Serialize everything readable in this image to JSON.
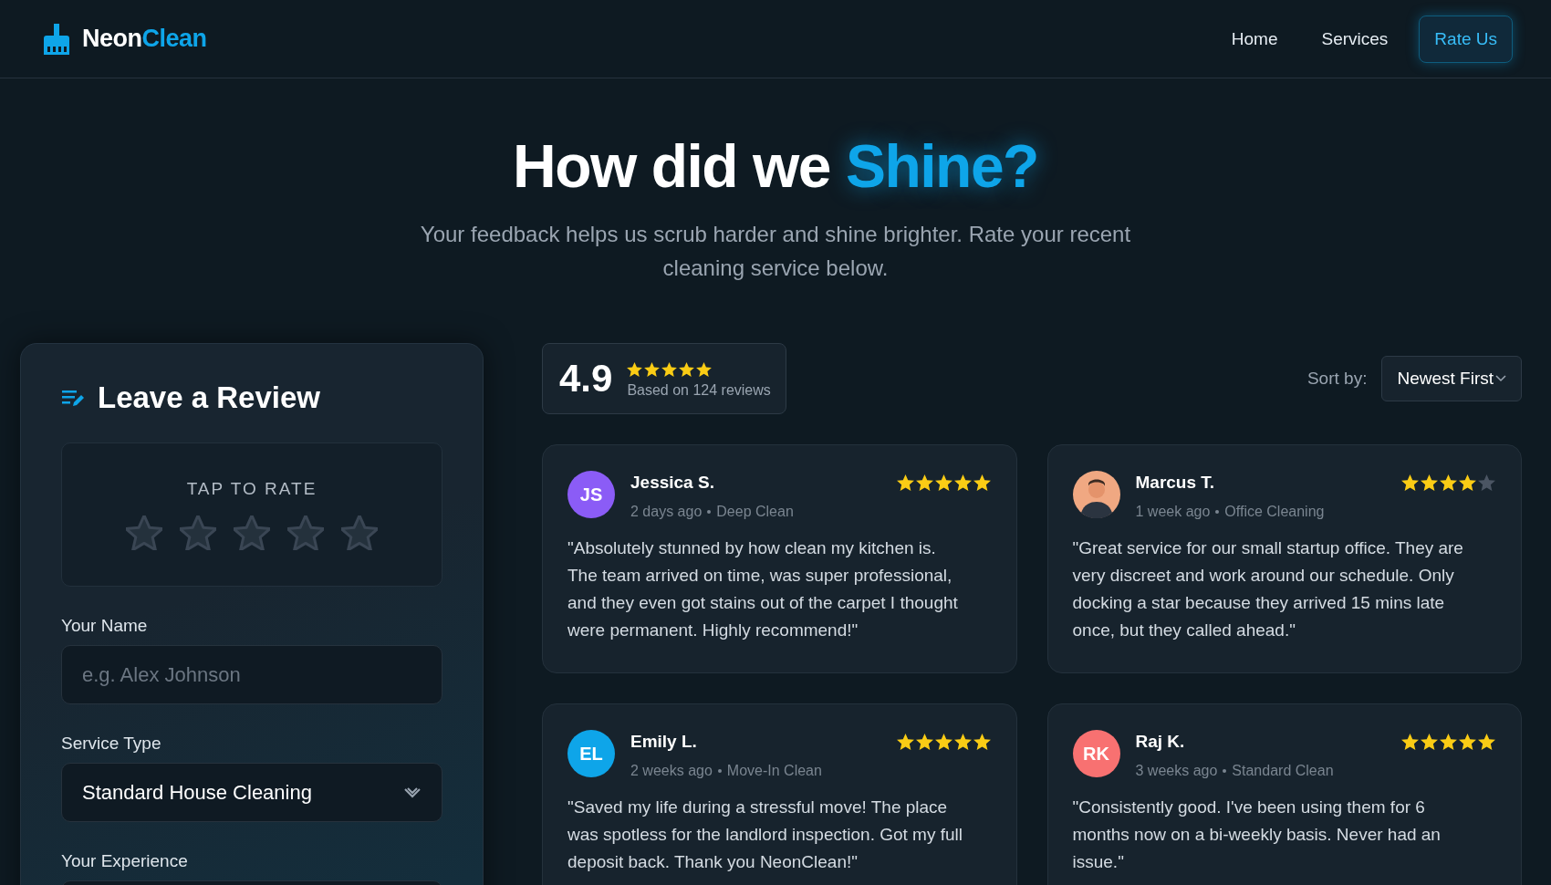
{
  "brand": {
    "name_plain": "Neon",
    "name_accent": "Clean"
  },
  "nav": [
    {
      "label": "Home",
      "selected": false
    },
    {
      "label": "Services",
      "selected": false
    },
    {
      "label": "Rate Us",
      "selected": true
    }
  ],
  "hero": {
    "title_plain": "How did we ",
    "title_accent": "Shine?",
    "subtitle": "Your feedback helps us scrub harder and shine brighter. Rate your recent cleaning service below."
  },
  "review_form": {
    "title": "Leave a Review",
    "rate_label": "TAP TO RATE",
    "stars": 0,
    "fields": [
      {
        "kind": "text",
        "label": "Your Name",
        "placeholder": "e.g. Alex Johnson"
      },
      {
        "kind": "select",
        "label": "Service Type",
        "value": "Standard House Cleaning"
      },
      {
        "kind": "textarea",
        "label": "Your Experience"
      }
    ]
  },
  "summary": {
    "score": "4.9",
    "stars": 5,
    "caption": "Based on 124 reviews"
  },
  "sort": {
    "label": "Sort by:",
    "value": "Newest First"
  },
  "reviews": [
    {
      "name": "Jessica S.",
      "avatar": {
        "kind": "initials",
        "initials": "JS",
        "color": "#8b5cf6"
      },
      "stars": 5,
      "time": "2 days ago",
      "service": "Deep Clean",
      "text": "\"Absolutely stunned by how clean my kitchen is. The team arrived on time, was super professional, and they even got stains out of the carpet I thought were permanent. Highly recommend!\""
    },
    {
      "name": "Marcus T.",
      "avatar": {
        "kind": "photo"
      },
      "stars": 4,
      "time": "1 week ago",
      "service": "Office Cleaning",
      "text": "\"Great service for our small startup office. They are very discreet and work around our schedule. Only docking a star because they arrived 15 mins late once, but they called ahead.\""
    },
    {
      "name": "Emily L.",
      "avatar": {
        "kind": "initials",
        "initials": "EL",
        "color": "#0ea5e9"
      },
      "stars": 5,
      "time": "2 weeks ago",
      "service": "Move-In Clean",
      "text": "\"Saved my life during a stressful move! The place was spotless for the landlord inspection. Got my full deposit back. Thank you NeonClean!\""
    },
    {
      "name": "Raj K.",
      "avatar": {
        "kind": "initials",
        "initials": "RK",
        "color": "#f87171"
      },
      "stars": 5,
      "time": "3 weeks ago",
      "service": "Standard Clean",
      "text": "\"Consistently good. I've been using them for 6 months now on a bi-weekly basis. Never had an issue.\""
    }
  ]
}
